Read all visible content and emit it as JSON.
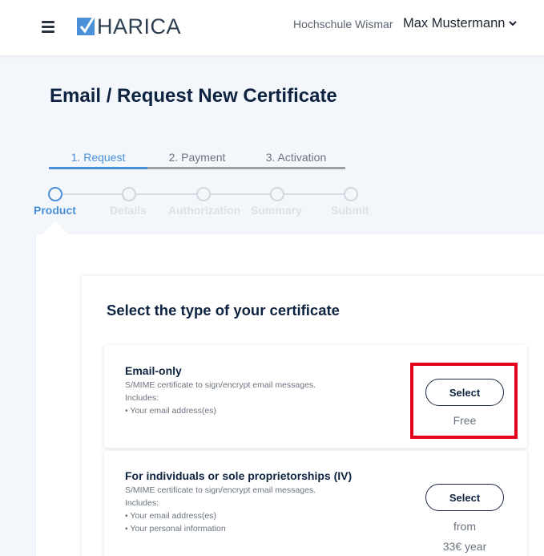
{
  "header": {
    "logo_text": "HARICA",
    "organization": "Hochschule Wismar",
    "user_name": "Max Mustermann"
  },
  "page": {
    "title": "Email / Request New Certificate"
  },
  "steps": [
    {
      "label": "1. Request",
      "active": true
    },
    {
      "label": "2. Payment",
      "active": false
    },
    {
      "label": "3. Activation",
      "active": false
    }
  ],
  "wizard": [
    {
      "label": "Product",
      "active": true
    },
    {
      "label": "Details",
      "active": false
    },
    {
      "label": "Authorization",
      "active": false
    },
    {
      "label": "Summary",
      "active": false
    },
    {
      "label": "Submit",
      "active": false
    }
  ],
  "section": {
    "title": "Select the type of your certificate"
  },
  "cards": [
    {
      "title": "Email-only",
      "description": "S/MIME certificate to sign/encrypt email messages.",
      "includes_label": "Includes:",
      "items": [
        "• Your email address(es)"
      ],
      "button_label": "Select",
      "price_line1": "Free",
      "price_line2": ""
    },
    {
      "title": "For individuals or sole proprietorships (IV)",
      "description": "S/MIME certificate to sign/encrypt email messages.",
      "includes_label": "Includes:",
      "items": [
        "• Your email address(es)",
        "• Your personal information"
      ],
      "button_label": "Select",
      "price_line1": "from",
      "price_line2": "33€ year"
    }
  ],
  "colors": {
    "accent": "#4a90d9",
    "highlight": "#e2001a",
    "text_dark": "#0d2340"
  }
}
